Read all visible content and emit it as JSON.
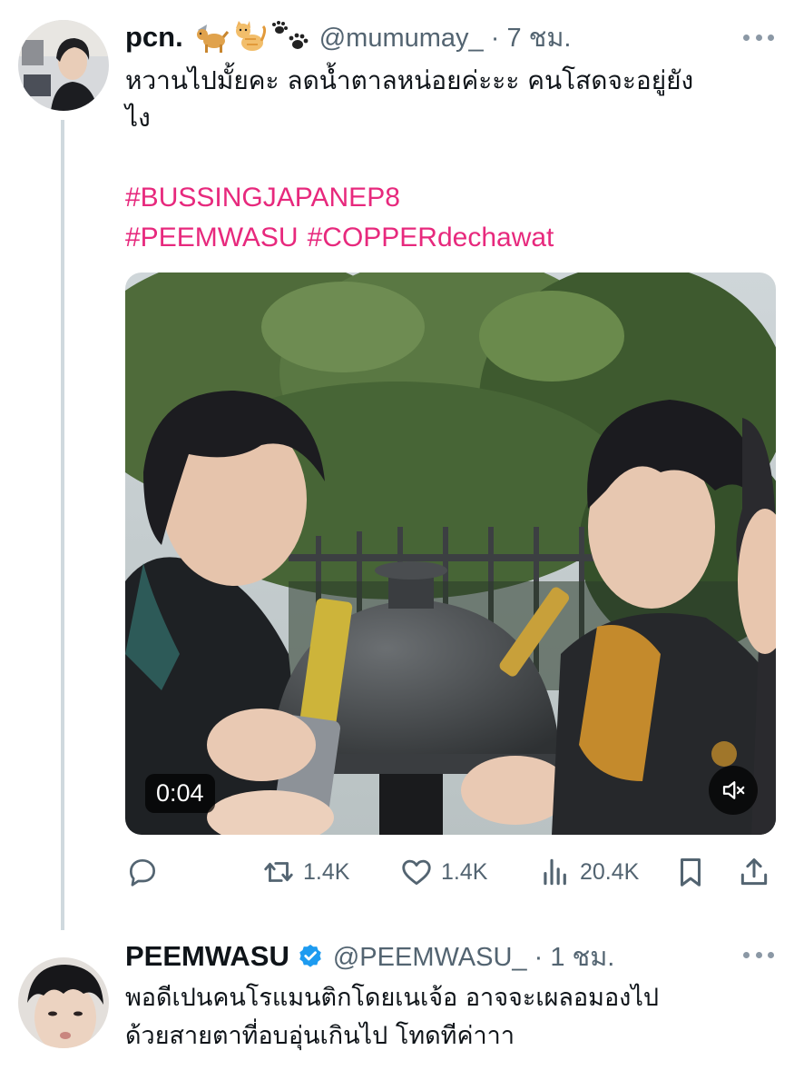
{
  "tweet1": {
    "display_name": "pcn.",
    "emojis": [
      "guide-dog-emoji",
      "cat-emoji",
      "paw-prints-emoji"
    ],
    "handle": "@mumumay_",
    "time": "· 7 ชม.",
    "text_line1": "หวานไปมั้ยคะ ลดน้ำตาลหน่อยค่ะะะ คนโสดจะอยู่ยัง",
    "text_line2": "ไง",
    "hashtags_line1": [
      "#BUSSINGJAPANEP8"
    ],
    "hashtags_line2": [
      "#PEEMWASU",
      "#COPPERdechawat"
    ],
    "video": {
      "duration": "0:04",
      "muted": true
    },
    "actions": {
      "reply_icon": "reply-icon",
      "retweets": "1.4K",
      "likes": "1.4K",
      "views": "20.4K"
    }
  },
  "tweet2": {
    "display_name": "PEEMWASU",
    "verified": true,
    "handle": "@PEEMWASU_",
    "time": "· 1 ชม.",
    "text_line1": "พอดีเปนคนโรแมนติกโดยเนเจ้อ อาจจะเผลอมองไป",
    "text_line2": "ด้วยสายตาที่อบอุ่นเกินไป โทดทีค่าาา"
  },
  "colors": {
    "text_primary": "#0f1419",
    "text_secondary": "#536471",
    "hashtag": "#e7297d",
    "verified": "#1d9bf0",
    "thread_line": "#cfd9de"
  }
}
